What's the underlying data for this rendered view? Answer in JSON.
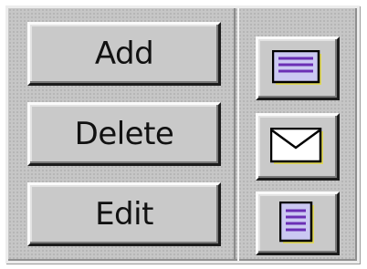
{
  "buttons": {
    "add_label": "Add",
    "delete_label": "Delete",
    "edit_label": "Edit"
  },
  "icon_buttons": [
    {
      "icon": "list-lines-icon"
    },
    {
      "icon": "envelope-icon"
    },
    {
      "icon": "document-lines-icon"
    }
  ],
  "colors": {
    "face": "#c9c9c9",
    "icon_fill": "#cbc8f2",
    "icon_lines": "#6b2fb5",
    "icon_shadow": "#e0d85a",
    "icon_outline": "#000000"
  }
}
